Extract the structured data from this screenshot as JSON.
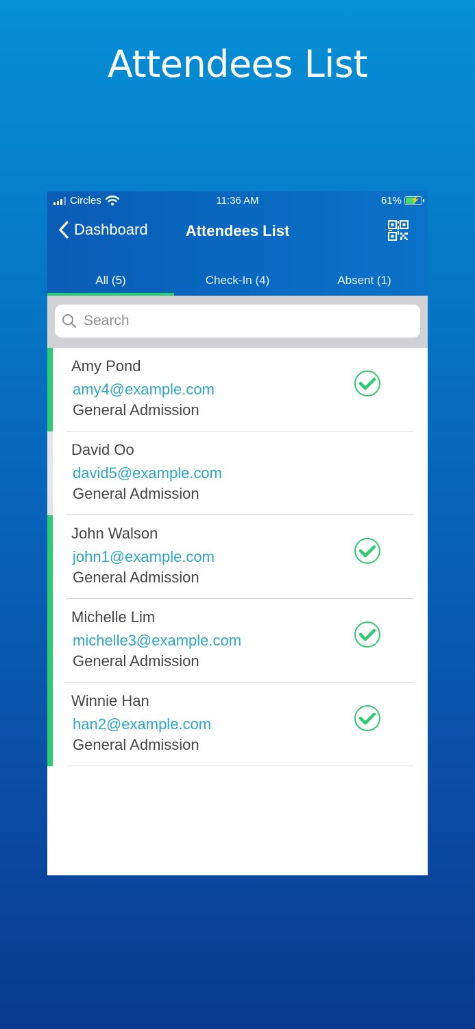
{
  "hero": {
    "title": "Attendees List"
  },
  "status_bar": {
    "carrier": "Circles",
    "time": "11:36 AM",
    "battery": "61%"
  },
  "nav": {
    "back_label": "Dashboard",
    "title": "Attendees List"
  },
  "tabs": [
    {
      "label": "All (5)",
      "active": true
    },
    {
      "label": "Check-In (4)",
      "active": false
    },
    {
      "label": "Absent (1)",
      "active": false
    }
  ],
  "search": {
    "placeholder": "Search"
  },
  "attendees": [
    {
      "name": "Amy Pond",
      "email": "amy4@example.com",
      "ticket": "General Admission",
      "checked_in": true
    },
    {
      "name": "David Oo",
      "email": "david5@example.com",
      "ticket": "General Admission",
      "checked_in": false
    },
    {
      "name": "John Walson",
      "email": "john1@example.com",
      "ticket": "General Admission",
      "checked_in": true
    },
    {
      "name": "Michelle Lim",
      "email": "michelle3@example.com",
      "ticket": "General Admission",
      "checked_in": true
    },
    {
      "name": "Winnie Han",
      "email": "han2@example.com",
      "ticket": "General Admission",
      "checked_in": true
    }
  ],
  "colors": {
    "checked_in": "#2ecc71",
    "absent": "#e5e5ea",
    "email": "#2aa7c9",
    "header": "#0868c0"
  }
}
